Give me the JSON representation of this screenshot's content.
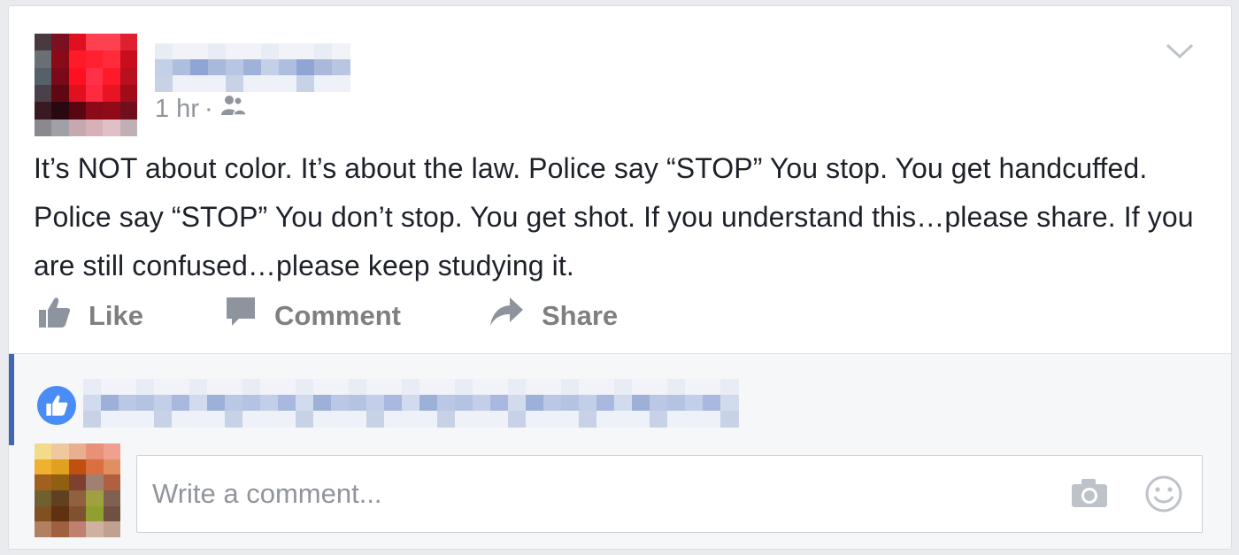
{
  "post": {
    "timestamp": "1 hr",
    "separator": "·",
    "audience_icon": "friends-icon",
    "text": "It’s NOT about color. It’s about the law. Police say “STOP”  You stop. You get handcuffed. Police say “STOP” You don’t stop. You get shot. If you understand this…please share. If you are still confused…please keep studying it."
  },
  "actions": {
    "like_label": "Like",
    "comment_label": "Comment",
    "share_label": "Share"
  },
  "comment_input": {
    "placeholder": "Write a comment..."
  },
  "icons": {
    "options": "chevron-down-icon",
    "like": "thumbs-up-icon",
    "comment": "speech-bubble-icon",
    "share": "share-arrow-icon",
    "reaction": "like-reaction-icon",
    "camera": "camera-icon",
    "emoji": "smiley-icon"
  },
  "colors": {
    "accent": "#4267b2",
    "like_badge": "#4a8cf6",
    "muted_text": "#90949c",
    "action_text": "#7f7f7f",
    "body_text": "#1d2129"
  }
}
